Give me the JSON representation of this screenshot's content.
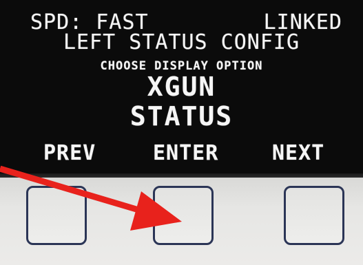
{
  "screen": {
    "speed_text": "SPD: FAST",
    "link_status": "LINKED",
    "menu_title": "LEFT STATUS CONFIG",
    "prompt": "CHOOSE DISPLAY OPTION",
    "option_line1": "XGUN",
    "option_line2": "STATUS",
    "softkeys": {
      "prev": "PREV",
      "enter": "ENTER",
      "next": "NEXT"
    }
  },
  "colors": {
    "oled_background": "#0b0b0b",
    "oled_text": "#f6f6f6",
    "key_border": "#2b3556",
    "panel": "#e6e6e4",
    "arrow": "#e8221c"
  },
  "annotation": {
    "icon": "red-arrow-icon",
    "points_to": "enter-key"
  }
}
